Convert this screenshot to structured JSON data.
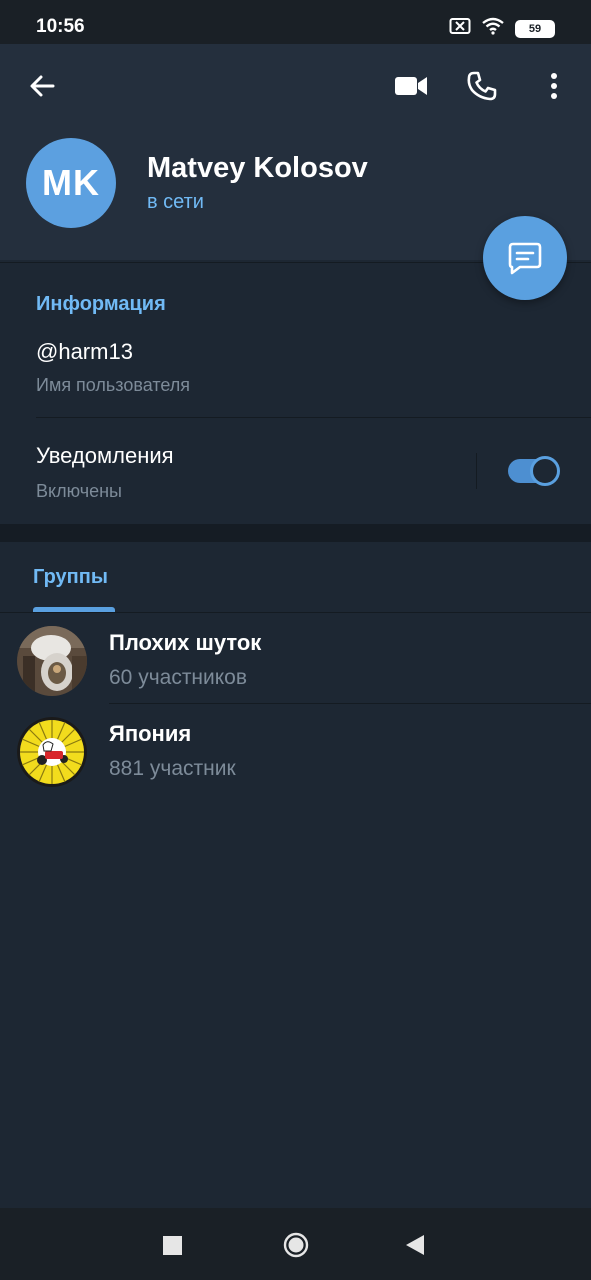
{
  "status_bar": {
    "time": "10:56",
    "battery": "59"
  },
  "header": {
    "avatar_initials": "MK",
    "name": "Matvey Kolosov",
    "presence": "в сети"
  },
  "info": {
    "title": "Информация",
    "username": "@harm13",
    "username_label": "Имя пользователя",
    "notifications_label": "Уведомления",
    "notifications_state": "Включены",
    "notifications_on": true
  },
  "groups_tab": {
    "label": "Группы"
  },
  "groups": [
    {
      "name": "Плохих шуток",
      "count": "60 участников"
    },
    {
      "name": "Япония",
      "count": "881 участник"
    }
  ],
  "colors": {
    "accent": "#5aa0e0",
    "link": "#71baf5",
    "background": "#1d2733",
    "header": "#242f3d"
  }
}
